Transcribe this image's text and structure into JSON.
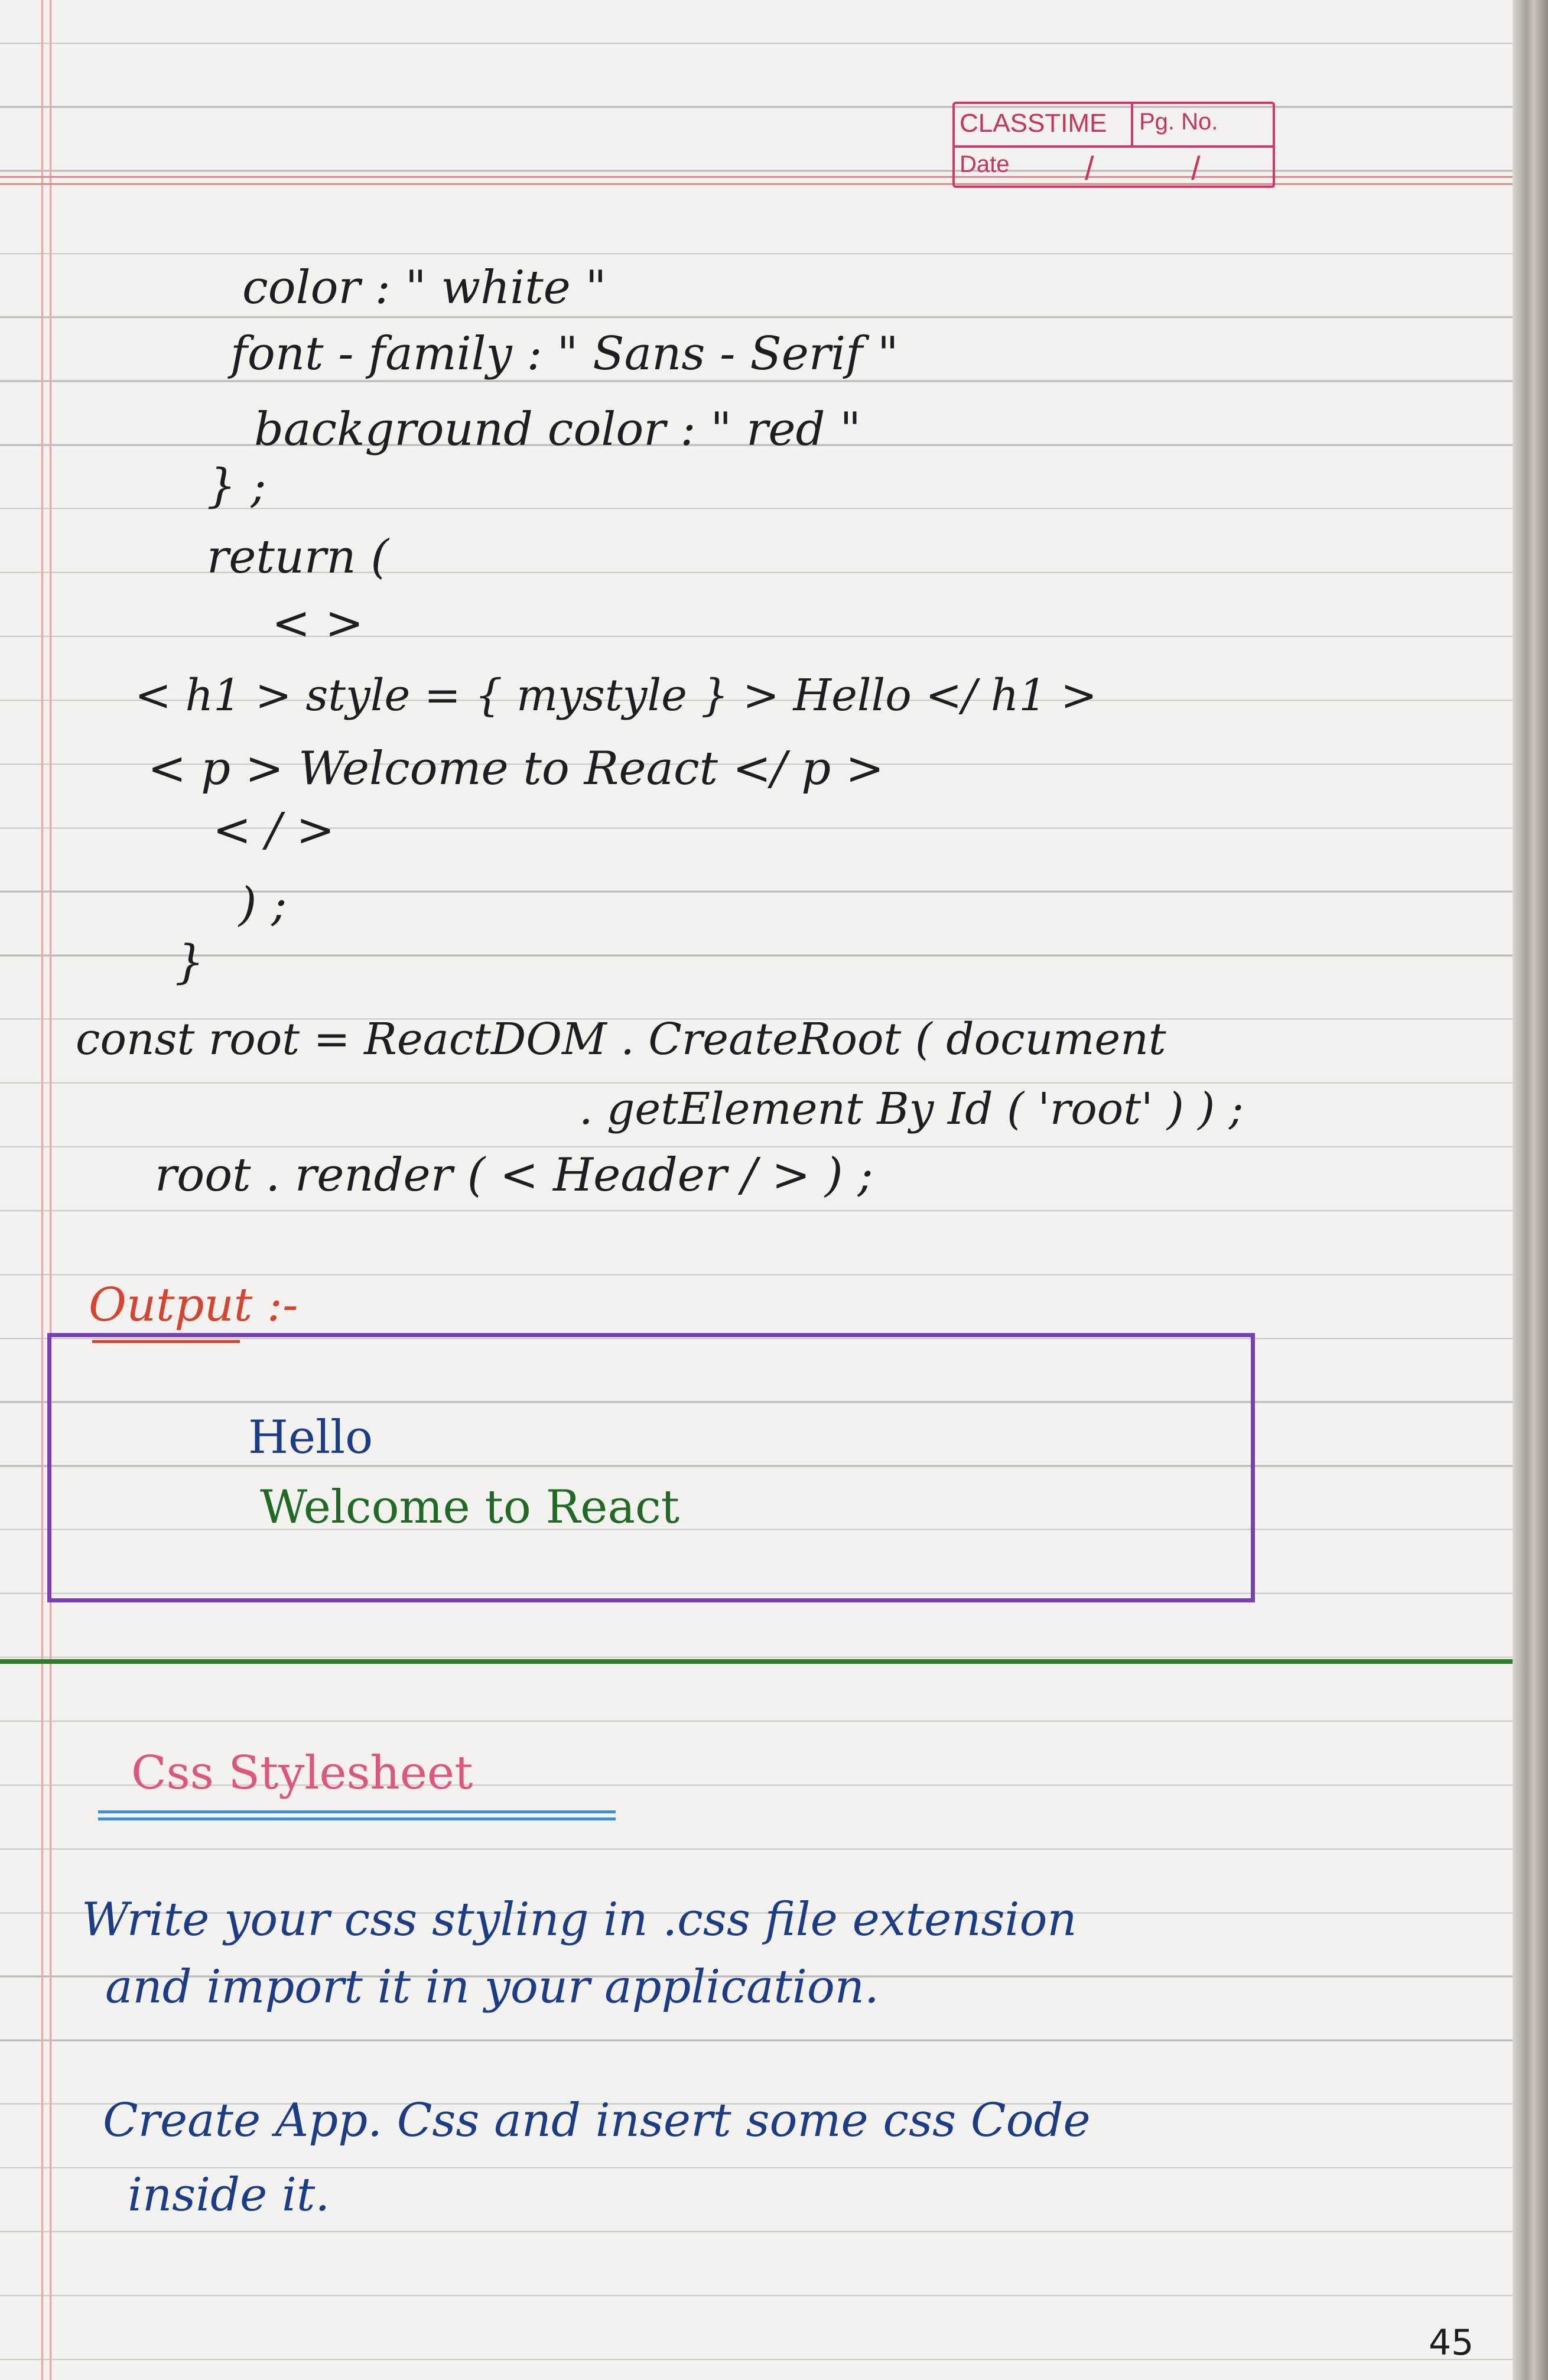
{
  "header": {
    "brand": "CLASSTIME",
    "page_no_label": "Pg. No.",
    "date_label": "Date",
    "date_sep_1": "/",
    "date_sep_2": "/"
  },
  "code_lines": [
    "color : \" white \"",
    "font - family : \" Sans - Serif \"",
    "background color : \" red \"",
    "} ;",
    "return (",
    "< >",
    "< h1 > style = { mystyle } > Hello </ h1 >",
    "< p > Welcome to React </ p >",
    "< / >",
    ") ;",
    "}",
    "const root = ReactDOM . CreateRoot ( document",
    ". getElement By Id ( 'root' ) ) ;",
    "root . render ( < Header / > ) ;"
  ],
  "output": {
    "label": "Output :-",
    "line1": "Hello",
    "line2": "Welcome to React"
  },
  "section": {
    "heading": "Css Stylesheet",
    "para1_line1": "Write your css styling in .css file extension",
    "para1_line2": "and import it in your application.",
    "para2_line1": "Create App. Css and insert some css Code",
    "para2_line2": "inside it."
  },
  "page_number": "45",
  "colors": {
    "ink": "#1d1d22",
    "blue_ink": "#1b3c86",
    "green_ink": "#1f6b25",
    "pink_ink": "#e0557d",
    "red_ink": "#d8432f",
    "box_purple": "#7a3fb8",
    "rule_green": "#2f7c2a"
  }
}
